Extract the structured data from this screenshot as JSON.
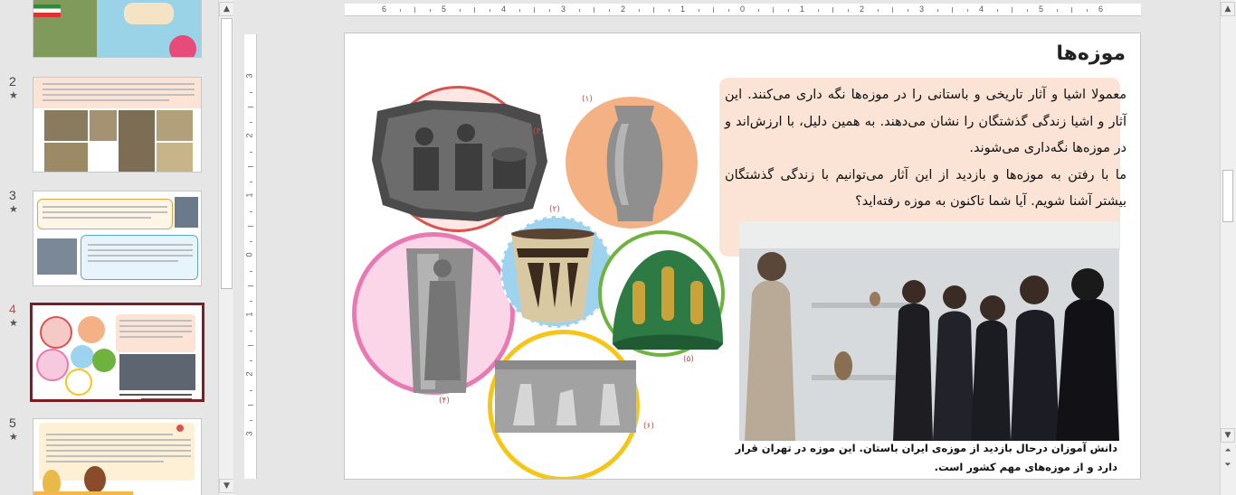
{
  "thumbnails": {
    "items": [
      {
        "number": "",
        "star": ""
      },
      {
        "number": "2",
        "star": "★"
      },
      {
        "number": "3",
        "star": "★"
      },
      {
        "number": "4",
        "star": "★"
      },
      {
        "number": "5",
        "star": "★"
      }
    ]
  },
  "ruler": {
    "h_labels": [
      "6",
      "5",
      "4",
      "3",
      "2",
      "1",
      "0",
      "1",
      "2",
      "3",
      "4",
      "5",
      "6"
    ],
    "v_labels": [
      "3",
      "2",
      "1",
      "0",
      "1",
      "2",
      "3"
    ]
  },
  "slide": {
    "title": "موزه‌ها",
    "paragraph1": "معمولا اشیا و آثار تاریخی و باستانی را در موزه‌ها نگه داری می‌کنند. این آثار و اشیا زندگی گذشتگان را نشان می‌دهند. به همین دلیل، با ارزش‌اند و در موزه‌ها نگه‌داری می‌شوند.",
    "paragraph2": "ما با رفتن به موزه‌ها و بازدید از این آثار می‌توانیم با زندگی گذشتگان بیشتر آشنا شویم. آیا شما تاکنون به موزه رفته‌اید؟",
    "caption": "دانش آموزان درحال بازدید از موزه‌ی ایران باستان. این موزه در تهران قرار دارد و از موزه‌های مهم کشور است.",
    "labels": [
      "(۱)",
      "(۲)",
      "(۳)",
      "(۴)",
      "(۵)",
      "(۶)"
    ]
  },
  "colors": {
    "accent_selected": "#7b1d22",
    "text_box_bg": "#fbe3d6",
    "circle_red": "#d9534f",
    "circle_orange": "#f4b183",
    "circle_blue": "#9dd3ef",
    "circle_pink": "#e879b3",
    "circle_green": "#6fb33f",
    "circle_yellow": "#f5c518"
  }
}
